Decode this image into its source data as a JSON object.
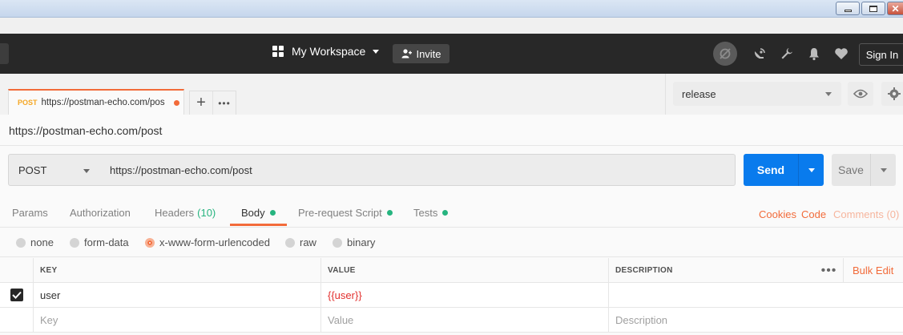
{
  "header": {
    "workspace_label": "My Workspace",
    "invite_label": "Invite",
    "signin_label": "Sign In"
  },
  "tabs": {
    "active": {
      "method": "POST",
      "url": "https://postman-echo.com/pos"
    }
  },
  "environment": {
    "selected": "release"
  },
  "request": {
    "name": "https://postman-echo.com/post",
    "method": "POST",
    "url": "https://postman-echo.com/post",
    "send_label": "Send",
    "save_label": "Save"
  },
  "sub_tabs": {
    "params": "Params",
    "authorization": "Authorization",
    "headers": "Headers",
    "headers_count": "(10)",
    "body": "Body",
    "prerequest": "Pre-request Script",
    "tests": "Tests",
    "cookies": "Cookies",
    "code": "Code",
    "comments": "Comments (0)"
  },
  "body_types": {
    "none": "none",
    "form_data": "form-data",
    "urlencoded": "x-www-form-urlencoded",
    "raw": "raw",
    "binary": "binary",
    "selected": "x-www-form-urlencoded"
  },
  "kv_table": {
    "col_key": "KEY",
    "col_value": "VALUE",
    "col_description": "DESCRIPTION",
    "more": "•••",
    "bulk_edit": "Bulk Edit",
    "rows": [
      {
        "key": "user",
        "value": "{{user}}",
        "description": "",
        "checked": true
      }
    ],
    "placeholder": {
      "key": "Key",
      "value": "Value",
      "description": "Description"
    }
  },
  "colors": {
    "accent": "#f26b3a",
    "primary": "#097bed",
    "header_bg": "#282828",
    "green": "#26b47f",
    "variable": "#e2302e"
  }
}
